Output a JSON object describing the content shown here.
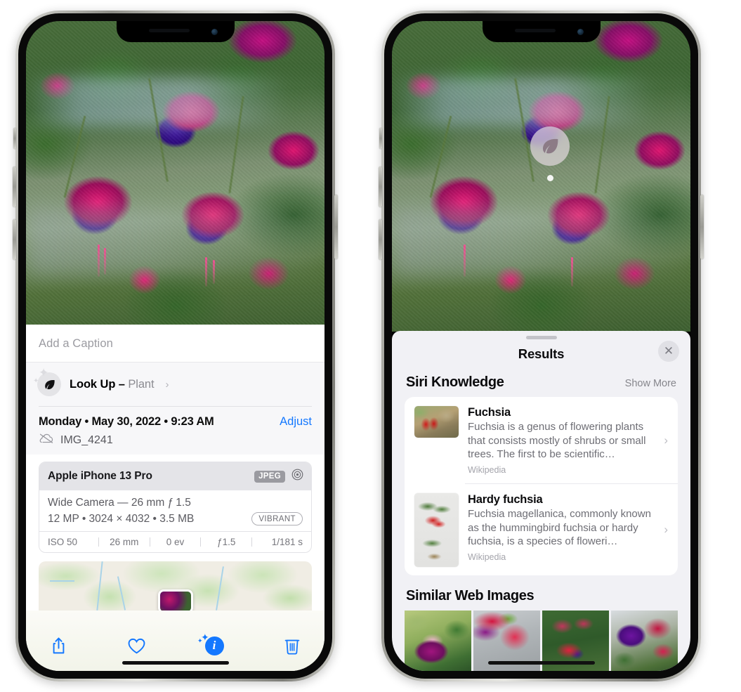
{
  "left_phone": {
    "name": "Photos detail view",
    "caption": {
      "placeholder": "Add a Caption",
      "value": ""
    },
    "lookup_row": {
      "icon": "leaf-icon",
      "label": "Look Up",
      "dash": " – ",
      "subject": "Plant",
      "chevron": "›"
    },
    "meta": {
      "date": "Monday • May 30, 2022 • 9:23 AM",
      "adjust": "Adjust",
      "filename": "IMG_4241",
      "cloud_icon": "icloud-slash-icon"
    },
    "camera_card": {
      "device": "Apple iPhone 13 Pro",
      "format_badge": "JPEG",
      "aperture_icon": "aperture-icon",
      "lens_line": "Wide Camera — 26 mm ƒ 1.5",
      "detail_line": "12 MP • 3024 × 4032 • 3.5 MB",
      "style_badge": "VIBRANT",
      "exif": [
        {
          "label": "ISO 50"
        },
        {
          "label": "26 mm"
        },
        {
          "label": "0 ev"
        },
        {
          "label": "ƒ1.5"
        },
        {
          "label": "1/181 s"
        }
      ]
    },
    "toolbar": [
      {
        "name": "share-button",
        "icon": "share-icon"
      },
      {
        "name": "favorite-button",
        "icon": "heart-icon"
      },
      {
        "name": "info-button",
        "icon": "info-sparkle-icon"
      },
      {
        "name": "delete-button",
        "icon": "trash-icon"
      }
    ],
    "map": {
      "name": "location-map-preview",
      "pin": "photo-pin"
    }
  },
  "right_phone": {
    "name": "Visual Look Up results",
    "badge": {
      "icon": "leaf-icon",
      "name": "look-up-badge"
    },
    "sheet": {
      "grabber": "sheet-grabber",
      "title": "Results",
      "close_icon": "✕"
    },
    "siri_knowledge": {
      "title": "Siri Knowledge",
      "show_more": "Show More",
      "items": [
        {
          "title": "Fuchsia",
          "snippet": "Fuchsia is a genus of flowering plants that consists mostly of shrubs or small trees. The first to be scientific…",
          "source": "Wikipedia",
          "chevron": "›"
        },
        {
          "title": "Hardy fuchsia",
          "snippet": "Fuchsia magellanica, commonly known as the hummingbird fuchsia or hardy fuchsia, is a species of floweri…",
          "source": "Wikipedia",
          "chevron": "›"
        }
      ]
    },
    "similar_web_images": {
      "title": "Similar Web Images",
      "count": 4
    }
  },
  "colors": {
    "accent_blue": "#1478ff",
    "sheet_bg": "#f1f1f5",
    "card_bg": "#ffffff",
    "secondary_text": "#6e6e75",
    "badge_gray": "#9a9aa0"
  }
}
